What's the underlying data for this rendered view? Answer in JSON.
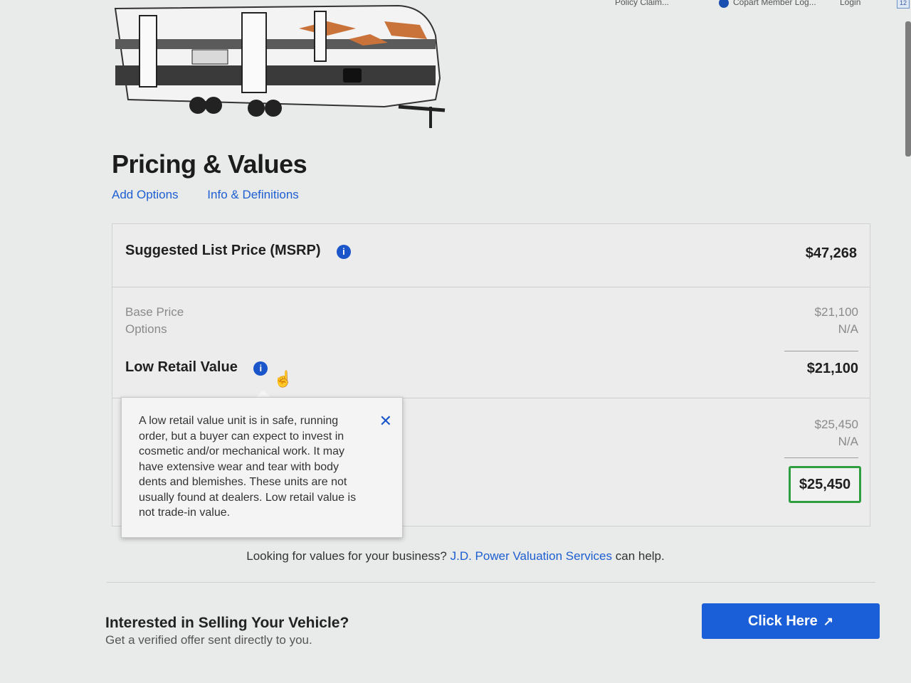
{
  "bookmarks": {
    "item1": "Policy Claim...",
    "item2": "Copart Member Log...",
    "item3": "Login",
    "badge": "12"
  },
  "heading": "Pricing & Values",
  "links": {
    "add_options": "Add Options",
    "info_definitions": "Info & Definitions"
  },
  "msrp": {
    "label": "Suggested List Price (MSRP)",
    "value": "$47,268",
    "info_glyph": "i"
  },
  "low_breakdown": {
    "base_label": "Base Price",
    "base_value": "$21,100",
    "options_label": "Options",
    "options_value": "N/A"
  },
  "low_retail": {
    "label": "Low Retail Value",
    "value": "$21,100",
    "info_glyph": "i"
  },
  "avg_breakdown": {
    "base_value": "$25,450",
    "options_value": "N/A"
  },
  "avg_retail": {
    "value": "$25,450"
  },
  "tooltip": {
    "text": "A low retail value unit is in safe, running order, but a buyer can expect to invest in cosmetic and/or mechanical work. It may have extensive wear and tear with body dents and blemishes. These units are not usually found at dealers. Low retail value is not trade-in value.",
    "close": "✕"
  },
  "business": {
    "prefix": "Looking for values for your business?",
    "link": "J.D. Power Valuation Services",
    "suffix": "can help."
  },
  "sell": {
    "title": "Interested in Selling Your Vehicle?",
    "subtitle": "Get a verified offer sent directly to you.",
    "button": "Click Here",
    "button_icon": "↗"
  },
  "colors": {
    "link": "#1d5fd1",
    "button": "#1a5fd8",
    "highlight_border": "#2e9e3e"
  }
}
